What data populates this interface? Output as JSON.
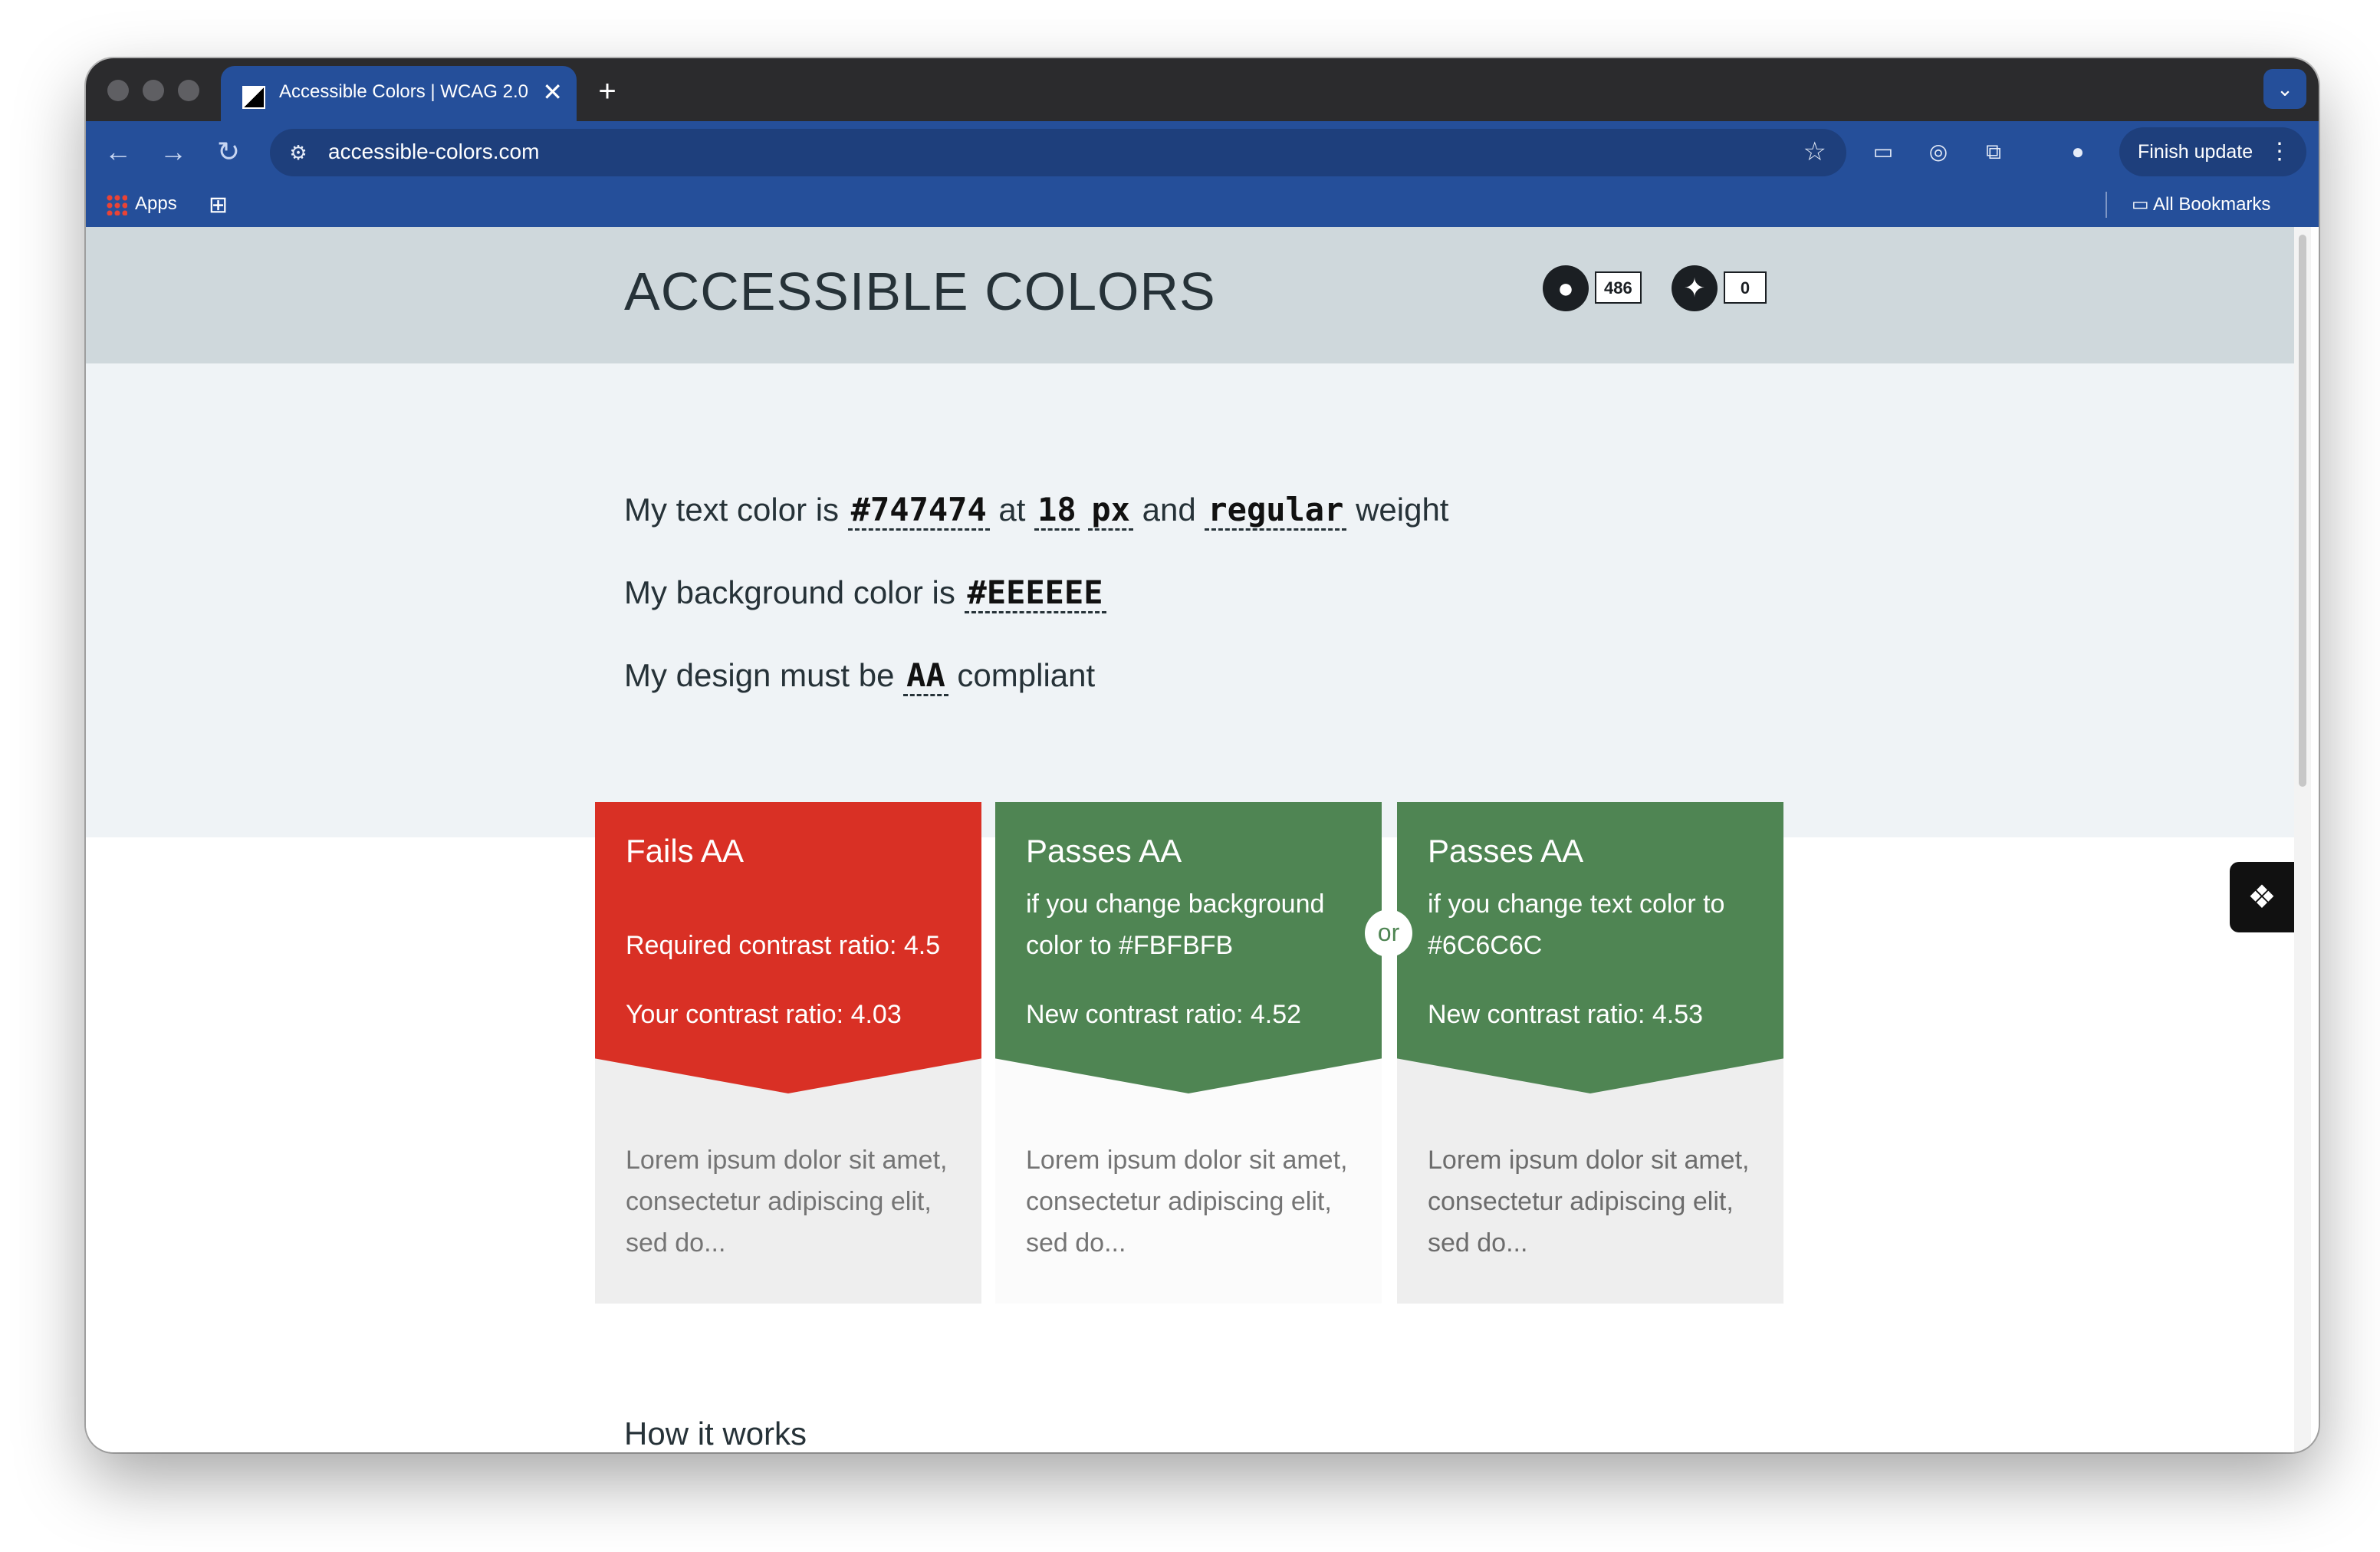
{
  "browser": {
    "tab_title": "Accessible Colors | WCAG 2.0",
    "tab_close": "✕",
    "new_tab": "+",
    "tab_menu": "⌄",
    "url": "accessible-colors.com",
    "finish_update": "Finish update",
    "bookmarks": {
      "apps": "Apps",
      "all_bookmarks": "All Bookmarks"
    }
  },
  "site": {
    "title": "ACCESSIBLE COLORS",
    "github_count": "486",
    "twitter_count": "0"
  },
  "form": {
    "s1_pre": "My text color is",
    "text_color": "#747474",
    "s1_at": "at",
    "font_size": "18",
    "font_unit": "px",
    "s1_and": "and",
    "weight": "regular",
    "s1_post": "weight",
    "s2_pre": "My background color is",
    "bg_color": "#EEEEEE",
    "s3_pre": "My design must be",
    "level": "AA",
    "s3_post": "compliant"
  },
  "cards": [
    {
      "heading": "Fails AA",
      "line1": "Required contrast ratio: 4.5",
      "line2": "Your contrast ratio: 4.03",
      "lorem": "Lorem ipsum dolor sit amet, consectetur adipiscing elit, sed do...",
      "color": "#d93025",
      "bottom_bg": "#eeeeee"
    },
    {
      "heading": "Passes AA",
      "line1": "if you change background color to #FBFBFB",
      "line2": "New contrast ratio: 4.52",
      "lorem": "Lorem ipsum dolor sit amet, consectetur adipiscing elit, sed do...",
      "color": "#4f8553",
      "bottom_bg": "#fbfbfb"
    },
    {
      "heading": "Passes AA",
      "line1": "if you change text color to #6C6C6C",
      "line2": "New contrast ratio: 4.53",
      "lorem": "Lorem ipsum dolor sit amet, consectetur adipiscing elit, sed do...",
      "color": "#4f8553",
      "bottom_bg": "#eeeeee"
    }
  ],
  "or_label": "or",
  "how_it_works": "How it works",
  "colors": {
    "accent": "#254f9a",
    "fail": "#d93025",
    "pass": "#4f8553",
    "header_band": "#cfd8dc",
    "form_band": "#eff3f6"
  }
}
